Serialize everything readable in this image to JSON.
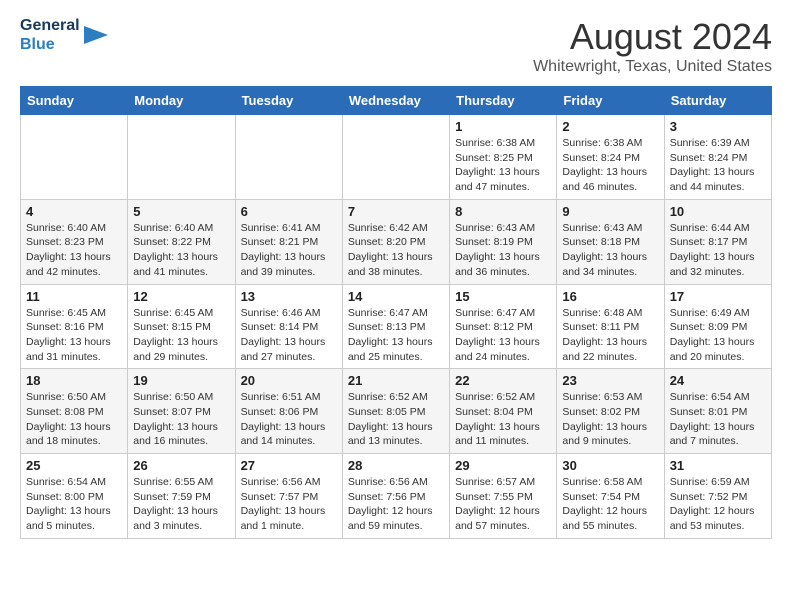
{
  "header": {
    "logo_line1": "General",
    "logo_line2": "Blue",
    "month": "August 2024",
    "location": "Whitewright, Texas, United States"
  },
  "weekdays": [
    "Sunday",
    "Monday",
    "Tuesday",
    "Wednesday",
    "Thursday",
    "Friday",
    "Saturday"
  ],
  "weeks": [
    [
      {
        "day": "",
        "sunrise": "",
        "sunset": "",
        "daylight": ""
      },
      {
        "day": "",
        "sunrise": "",
        "sunset": "",
        "daylight": ""
      },
      {
        "day": "",
        "sunrise": "",
        "sunset": "",
        "daylight": ""
      },
      {
        "day": "",
        "sunrise": "",
        "sunset": "",
        "daylight": ""
      },
      {
        "day": "1",
        "sunrise": "Sunrise: 6:38 AM",
        "sunset": "Sunset: 8:25 PM",
        "daylight": "Daylight: 13 hours and 47 minutes."
      },
      {
        "day": "2",
        "sunrise": "Sunrise: 6:38 AM",
        "sunset": "Sunset: 8:24 PM",
        "daylight": "Daylight: 13 hours and 46 minutes."
      },
      {
        "day": "3",
        "sunrise": "Sunrise: 6:39 AM",
        "sunset": "Sunset: 8:24 PM",
        "daylight": "Daylight: 13 hours and 44 minutes."
      }
    ],
    [
      {
        "day": "4",
        "sunrise": "Sunrise: 6:40 AM",
        "sunset": "Sunset: 8:23 PM",
        "daylight": "Daylight: 13 hours and 42 minutes."
      },
      {
        "day": "5",
        "sunrise": "Sunrise: 6:40 AM",
        "sunset": "Sunset: 8:22 PM",
        "daylight": "Daylight: 13 hours and 41 minutes."
      },
      {
        "day": "6",
        "sunrise": "Sunrise: 6:41 AM",
        "sunset": "Sunset: 8:21 PM",
        "daylight": "Daylight: 13 hours and 39 minutes."
      },
      {
        "day": "7",
        "sunrise": "Sunrise: 6:42 AM",
        "sunset": "Sunset: 8:20 PM",
        "daylight": "Daylight: 13 hours and 38 minutes."
      },
      {
        "day": "8",
        "sunrise": "Sunrise: 6:43 AM",
        "sunset": "Sunset: 8:19 PM",
        "daylight": "Daylight: 13 hours and 36 minutes."
      },
      {
        "day": "9",
        "sunrise": "Sunrise: 6:43 AM",
        "sunset": "Sunset: 8:18 PM",
        "daylight": "Daylight: 13 hours and 34 minutes."
      },
      {
        "day": "10",
        "sunrise": "Sunrise: 6:44 AM",
        "sunset": "Sunset: 8:17 PM",
        "daylight": "Daylight: 13 hours and 32 minutes."
      }
    ],
    [
      {
        "day": "11",
        "sunrise": "Sunrise: 6:45 AM",
        "sunset": "Sunset: 8:16 PM",
        "daylight": "Daylight: 13 hours and 31 minutes."
      },
      {
        "day": "12",
        "sunrise": "Sunrise: 6:45 AM",
        "sunset": "Sunset: 8:15 PM",
        "daylight": "Daylight: 13 hours and 29 minutes."
      },
      {
        "day": "13",
        "sunrise": "Sunrise: 6:46 AM",
        "sunset": "Sunset: 8:14 PM",
        "daylight": "Daylight: 13 hours and 27 minutes."
      },
      {
        "day": "14",
        "sunrise": "Sunrise: 6:47 AM",
        "sunset": "Sunset: 8:13 PM",
        "daylight": "Daylight: 13 hours and 25 minutes."
      },
      {
        "day": "15",
        "sunrise": "Sunrise: 6:47 AM",
        "sunset": "Sunset: 8:12 PM",
        "daylight": "Daylight: 13 hours and 24 minutes."
      },
      {
        "day": "16",
        "sunrise": "Sunrise: 6:48 AM",
        "sunset": "Sunset: 8:11 PM",
        "daylight": "Daylight: 13 hours and 22 minutes."
      },
      {
        "day": "17",
        "sunrise": "Sunrise: 6:49 AM",
        "sunset": "Sunset: 8:09 PM",
        "daylight": "Daylight: 13 hours and 20 minutes."
      }
    ],
    [
      {
        "day": "18",
        "sunrise": "Sunrise: 6:50 AM",
        "sunset": "Sunset: 8:08 PM",
        "daylight": "Daylight: 13 hours and 18 minutes."
      },
      {
        "day": "19",
        "sunrise": "Sunrise: 6:50 AM",
        "sunset": "Sunset: 8:07 PM",
        "daylight": "Daylight: 13 hours and 16 minutes."
      },
      {
        "day": "20",
        "sunrise": "Sunrise: 6:51 AM",
        "sunset": "Sunset: 8:06 PM",
        "daylight": "Daylight: 13 hours and 14 minutes."
      },
      {
        "day": "21",
        "sunrise": "Sunrise: 6:52 AM",
        "sunset": "Sunset: 8:05 PM",
        "daylight": "Daylight: 13 hours and 13 minutes."
      },
      {
        "day": "22",
        "sunrise": "Sunrise: 6:52 AM",
        "sunset": "Sunset: 8:04 PM",
        "daylight": "Daylight: 13 hours and 11 minutes."
      },
      {
        "day": "23",
        "sunrise": "Sunrise: 6:53 AM",
        "sunset": "Sunset: 8:02 PM",
        "daylight": "Daylight: 13 hours and 9 minutes."
      },
      {
        "day": "24",
        "sunrise": "Sunrise: 6:54 AM",
        "sunset": "Sunset: 8:01 PM",
        "daylight": "Daylight: 13 hours and 7 minutes."
      }
    ],
    [
      {
        "day": "25",
        "sunrise": "Sunrise: 6:54 AM",
        "sunset": "Sunset: 8:00 PM",
        "daylight": "Daylight: 13 hours and 5 minutes."
      },
      {
        "day": "26",
        "sunrise": "Sunrise: 6:55 AM",
        "sunset": "Sunset: 7:59 PM",
        "daylight": "Daylight: 13 hours and 3 minutes."
      },
      {
        "day": "27",
        "sunrise": "Sunrise: 6:56 AM",
        "sunset": "Sunset: 7:57 PM",
        "daylight": "Daylight: 13 hours and 1 minute."
      },
      {
        "day": "28",
        "sunrise": "Sunrise: 6:56 AM",
        "sunset": "Sunset: 7:56 PM",
        "daylight": "Daylight: 12 hours and 59 minutes."
      },
      {
        "day": "29",
        "sunrise": "Sunrise: 6:57 AM",
        "sunset": "Sunset: 7:55 PM",
        "daylight": "Daylight: 12 hours and 57 minutes."
      },
      {
        "day": "30",
        "sunrise": "Sunrise: 6:58 AM",
        "sunset": "Sunset: 7:54 PM",
        "daylight": "Daylight: 12 hours and 55 minutes."
      },
      {
        "day": "31",
        "sunrise": "Sunrise: 6:59 AM",
        "sunset": "Sunset: 7:52 PM",
        "daylight": "Daylight: 12 hours and 53 minutes."
      }
    ]
  ]
}
